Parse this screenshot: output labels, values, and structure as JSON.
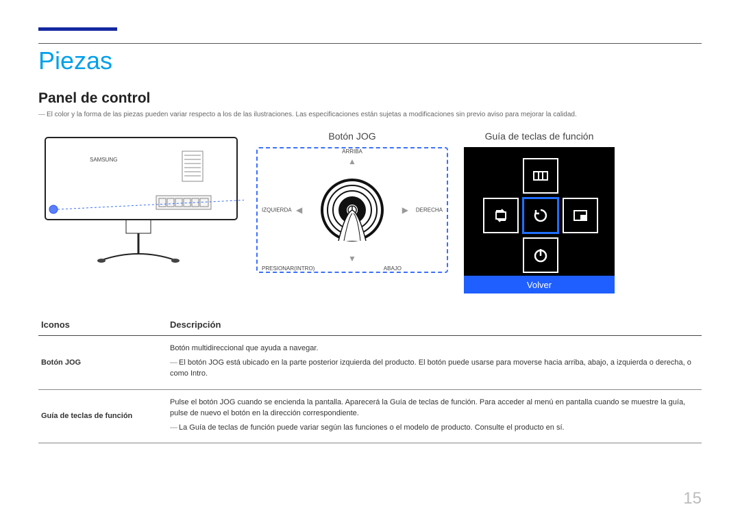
{
  "page_title": "Piezas",
  "subtitle": "Panel de control",
  "note": "El color y la forma de las piezas pueden variar respecto a los de las ilustraciones. Las especificaciones están sujetas a modificaciones sin previo aviso para mejorar la calidad.",
  "monitor_brand": "SAMSUNG",
  "jog": {
    "title": "Botón JOG",
    "up": "ARRIBA",
    "down": "ABAJO",
    "left": "IZQUIERDA",
    "right": "DERECHA",
    "press": "PRESIONAR(INTRO)"
  },
  "guide": {
    "title": "Guía de teclas de función",
    "return_label": "Volver"
  },
  "table": {
    "col_icons": "Iconos",
    "col_desc": "Descripción",
    "rows": [
      {
        "icon": "Botón JOG",
        "lines": [
          "Botón multidireccional que ayuda a navegar.",
          "El botón JOG está ubicado en la parte posterior izquierda del producto. El botón puede usarse para moverse hacia arriba, abajo, a izquierda o derecha, o como Intro."
        ],
        "line2_has_dash": true
      },
      {
        "icon": "Guía de teclas de función",
        "lines": [
          "Pulse el botón JOG cuando se encienda la pantalla. Aparecerá la Guía de teclas de función. Para acceder al menú en pantalla cuando se muestre la guía, pulse de nuevo el botón en la dirección correspondiente.",
          "La Guía de teclas de función puede variar según las funciones o el modelo de producto. Consulte el producto en sí."
        ],
        "line2_has_dash": true
      }
    ]
  },
  "page_number": "15"
}
